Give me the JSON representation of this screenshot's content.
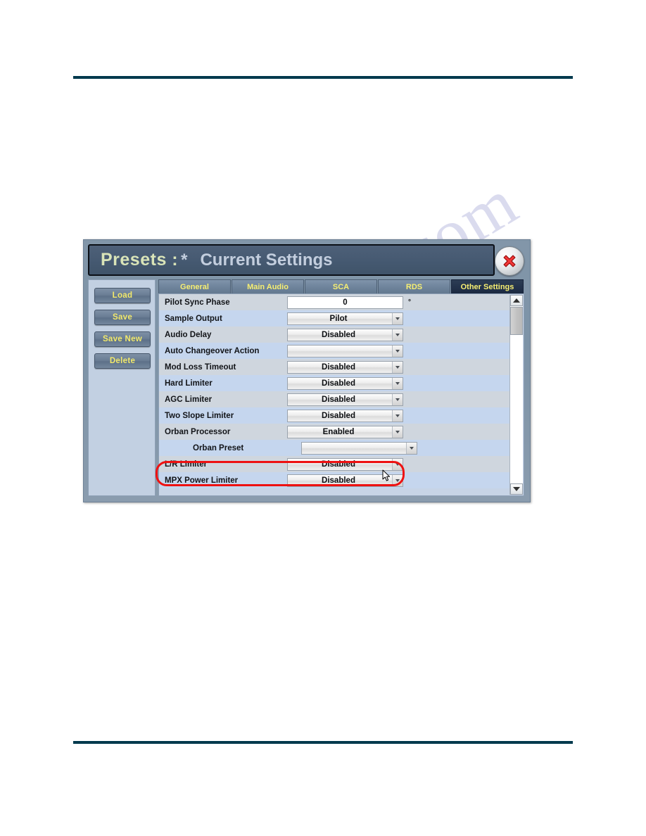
{
  "watermark": {
    "text": "manualslib.com"
  },
  "dialog": {
    "title": {
      "prefix": "Presets :",
      "star": "*",
      "name": "Current Settings"
    },
    "close_label": "close-icon",
    "sidebar": {
      "buttons": [
        {
          "label": "Load"
        },
        {
          "label": "Save"
        },
        {
          "label": "Save New"
        },
        {
          "label": "Delete"
        }
      ]
    },
    "tabs": [
      {
        "label": "General",
        "active": false
      },
      {
        "label": "Main Audio",
        "active": false
      },
      {
        "label": "SCA",
        "active": false
      },
      {
        "label": "RDS",
        "active": false
      },
      {
        "label": "Other Settings",
        "active": true
      }
    ],
    "settings": [
      {
        "label": "Pilot Sync Phase",
        "value": "0",
        "type": "input",
        "unit": "°"
      },
      {
        "label": "Sample Output",
        "value": "Pilot",
        "type": "combo"
      },
      {
        "label": "Audio Delay",
        "value": "Disabled",
        "type": "combo"
      },
      {
        "label": "Auto Changeover Action",
        "value": "",
        "type": "combo"
      },
      {
        "label": "Mod Loss Timeout",
        "value": "Disabled",
        "type": "combo"
      },
      {
        "label": "Hard Limiter",
        "value": "Disabled",
        "type": "combo"
      },
      {
        "label": "AGC Limiter",
        "value": "Disabled",
        "type": "combo"
      },
      {
        "label": "Two Slope Limiter",
        "value": "Disabled",
        "type": "combo"
      },
      {
        "label": "Orban Processor",
        "value": "Enabled",
        "type": "combo",
        "highlighted": true
      },
      {
        "label": "Orban Preset",
        "value": "",
        "type": "combo",
        "indent": true
      },
      {
        "label": "L/R Limiter",
        "value": "Disabled",
        "type": "combo"
      },
      {
        "label": "MPX Power Limiter",
        "value": "Disabled",
        "type": "combo"
      }
    ],
    "scrollbar": {
      "up": "scroll-up-arrow",
      "down": "scroll-down-arrow"
    }
  },
  "colors": {
    "rule": "#00394d",
    "highlight": "#ee1111",
    "tab_text": "#f7ef72",
    "title_accent": "#d9e4b8"
  }
}
